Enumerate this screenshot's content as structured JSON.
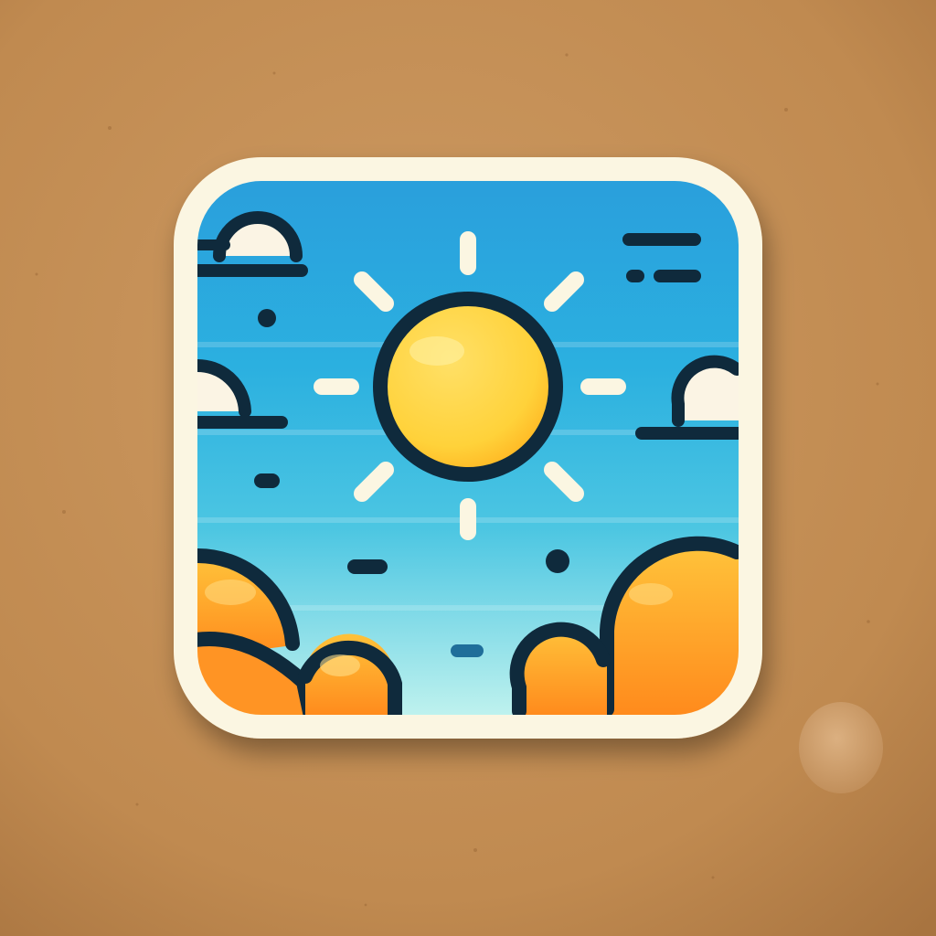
{
  "scene": {
    "background": "kraft-paper",
    "subject": "weather-app-icon-sticker"
  },
  "icon": {
    "name": "sunny-weather-icon",
    "elements": [
      "sun-icon",
      "cloud-icon",
      "orange-bush-icon"
    ]
  },
  "colors": {
    "paper": "#c08a50",
    "paper_light": "#cd9a62",
    "paper_dark": "#a87440",
    "sticker_border": "#fbf6e2",
    "sky_top": "#2a9fdc",
    "sky_bottom": "#bff2ee",
    "sun_fill": "#ffd23a",
    "sun_rim": "#ffb21f",
    "outline": "#0f2a3c",
    "rays": "#fbf6e2",
    "cloud_fill": "#fbf4e4",
    "bush_light": "#ffc23a",
    "bush_dark": "#ff8a1c",
    "drop": "#cf9e6b"
  }
}
